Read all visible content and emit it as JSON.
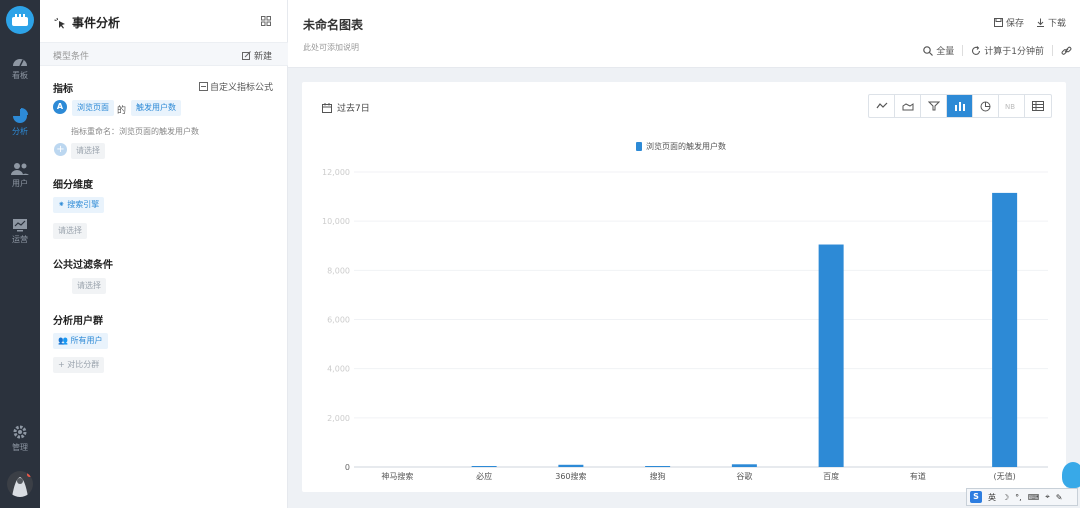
{
  "nav": {
    "items": [
      {
        "label": "看板",
        "icon": "dashboard-icon"
      },
      {
        "label": "分析",
        "icon": "pie-chart-icon",
        "active": true
      },
      {
        "label": "用户",
        "icon": "users-icon"
      },
      {
        "label": "运营",
        "icon": "monitor-icon"
      },
      {
        "label": "管理",
        "icon": "gear-icon"
      }
    ]
  },
  "panel": {
    "title": "事件分析",
    "model_condition": "模型条件",
    "new_label": "新建",
    "metric_title": "指标",
    "custom_formula": "自定义指标公式",
    "metric_badge": "A",
    "event_chip": "浏览页面",
    "of_text": "的",
    "measure_chip": "触发用户数",
    "rename_text": "指标重命名：浏览页面的触发用户数",
    "select_placeholder": "请选择",
    "breakdown_title": "细分维度",
    "breakdown_chip": "搜索引擎",
    "filter_title": "公共过滤条件",
    "segment_title": "分析用户群",
    "all_users_chip": "所有用户",
    "compare_label": "对比分群"
  },
  "main": {
    "chart_name": "未命名图表",
    "chart_desc": "此处可添加说明",
    "save": "保存",
    "download": "下载",
    "fullscreen": "全量",
    "calc_time": "计算于1分钟前",
    "date_range": "过去7日"
  },
  "ime": {
    "lang": "英",
    "icon": "S"
  },
  "colors": {
    "accent": "#2d8ad6",
    "nav_bg": "#2b323d"
  },
  "chart_data": {
    "type": "bar",
    "categories": [
      "神马搜索",
      "必应",
      "360搜索",
      "搜狗",
      "谷歌",
      "百度",
      "有道",
      "(无值)"
    ],
    "series": [
      {
        "name": "浏览页面的触发用户数",
        "values": [
          0,
          40,
          90,
          30,
          110,
          9050,
          0,
          11150
        ]
      }
    ],
    "y_ticks": [
      "0",
      "2,000",
      "4,000",
      "6,000",
      "8,000",
      "10,000",
      "12,000"
    ],
    "ylim": [
      0,
      12000
    ],
    "grid": true,
    "legend": "top-center",
    "chart_types": [
      "line-icon",
      "area-icon",
      "funnel-icon",
      "bar-icon",
      "pie-icon",
      "number-icon",
      "table-icon"
    ],
    "active_type": "bar-icon"
  }
}
